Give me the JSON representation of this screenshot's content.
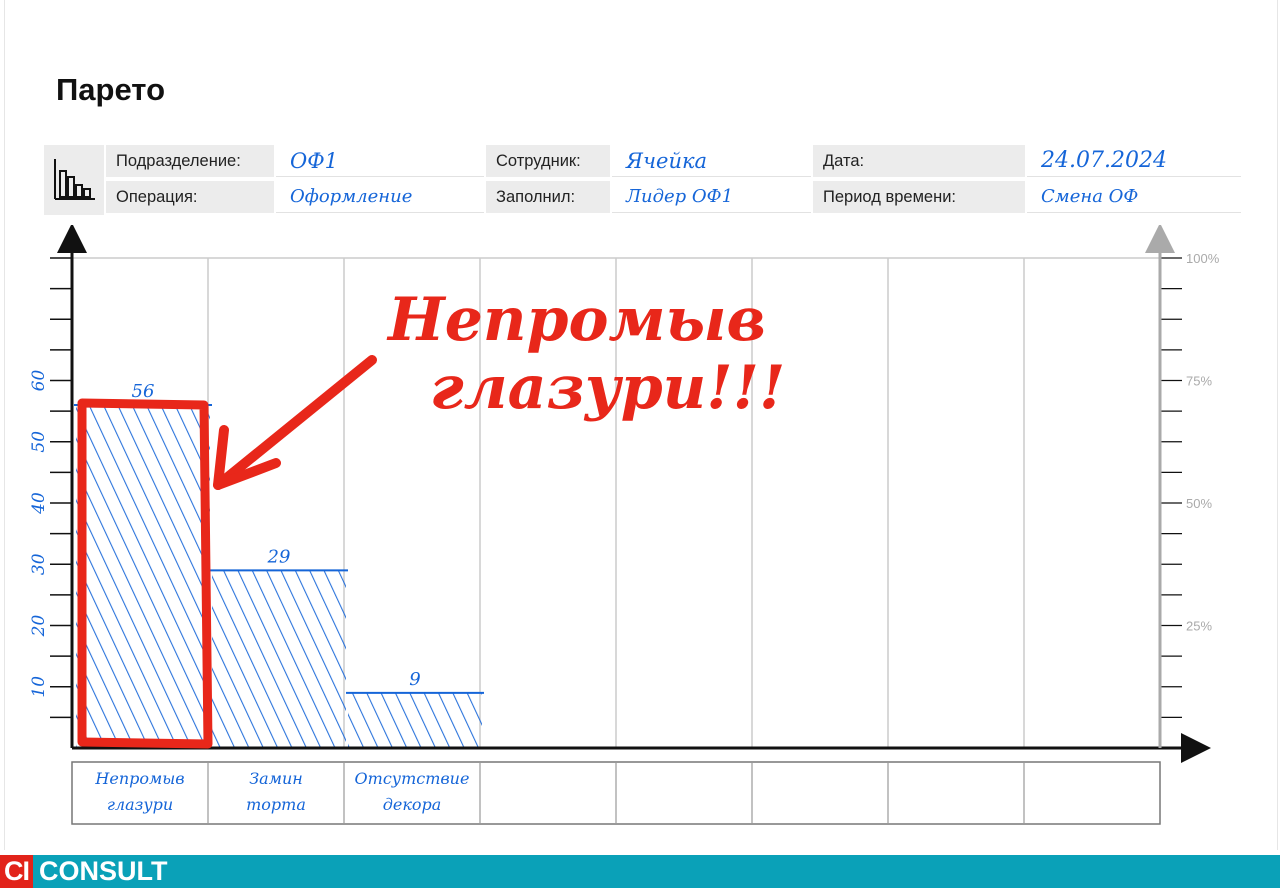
{
  "page": {
    "title": "Парето"
  },
  "header": {
    "icon": "bar-chart-icon",
    "fields": {
      "division_label": "Подразделение:",
      "division_value": "ОФ1",
      "operation_label": "Операция:",
      "operation_value": "Оформление",
      "employee_label": "Сотрудник:",
      "employee_value": "Ячейка",
      "filled_by_label": "Заполнил:",
      "filled_by_value": "Лидер ОФ1",
      "date_label": "Дата:",
      "date_value": "24.07.2024",
      "period_label": "Период времени:",
      "period_value": "Смена ОФ"
    }
  },
  "chart_data": {
    "type": "bar",
    "categories": [
      "Непромыв глазури",
      "Замин торта",
      "Отсутствие декора",
      "",
      "",
      "",
      "",
      ""
    ],
    "values": [
      56,
      29,
      9,
      null,
      null,
      null,
      null,
      null
    ],
    "data_labels": [
      "56",
      "29",
      "9"
    ],
    "y_ticks": [
      "10",
      "20",
      "30",
      "40",
      "50",
      "60"
    ],
    "y_tick_values": [
      10,
      20,
      30,
      40,
      50,
      60
    ],
    "ylim": [
      0,
      80
    ],
    "y2_ticks": [
      "100%",
      "75%",
      "50%",
      "25%"
    ],
    "y2_tick_values": [
      100,
      75,
      50,
      25
    ],
    "y2lim": [
      0,
      100
    ],
    "annotation": {
      "text_line1": "Непромыв",
      "text_line2": "глазури!!!",
      "highlight_category": 0
    },
    "colors": {
      "bars": "#1565d8",
      "annotation": "#e8271a",
      "axis": "#111111",
      "secondary_axis": "#aaaaaa",
      "grid": "#cccccc"
    },
    "grid": true
  },
  "footer": {
    "logo_ci": "CI",
    "logo_consult": "CONSULT"
  }
}
